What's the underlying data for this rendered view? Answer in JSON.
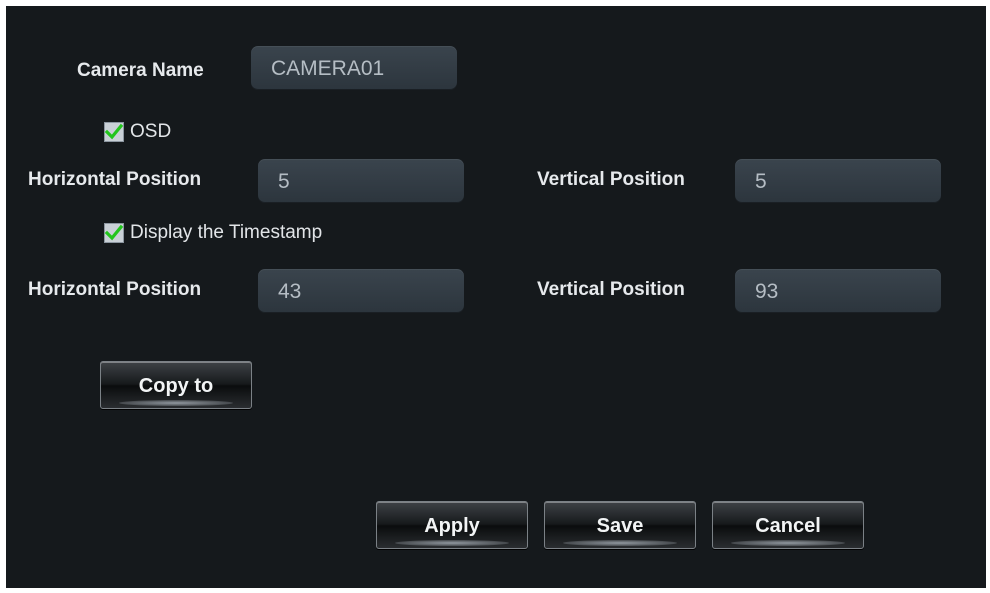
{
  "camera": {
    "name_label": "Camera Name",
    "name_value": "CAMERA01"
  },
  "osd": {
    "label": "OSD",
    "checked": true,
    "horizontal_label": "Horizontal Position",
    "horizontal_value": "5",
    "vertical_label": "Vertical Position",
    "vertical_value": "5"
  },
  "timestamp": {
    "label": "Display the Timestamp",
    "checked": true,
    "horizontal_label": "Horizontal Position",
    "horizontal_value": "43",
    "vertical_label": "Vertical Position",
    "vertical_value": "93"
  },
  "actions": {
    "copy_label": "Copy to",
    "apply_label": "Apply",
    "save_label": "Save",
    "cancel_label": "Cancel"
  },
  "colors": {
    "panel_bg": "#15191c",
    "check_green": "#22c51c"
  }
}
